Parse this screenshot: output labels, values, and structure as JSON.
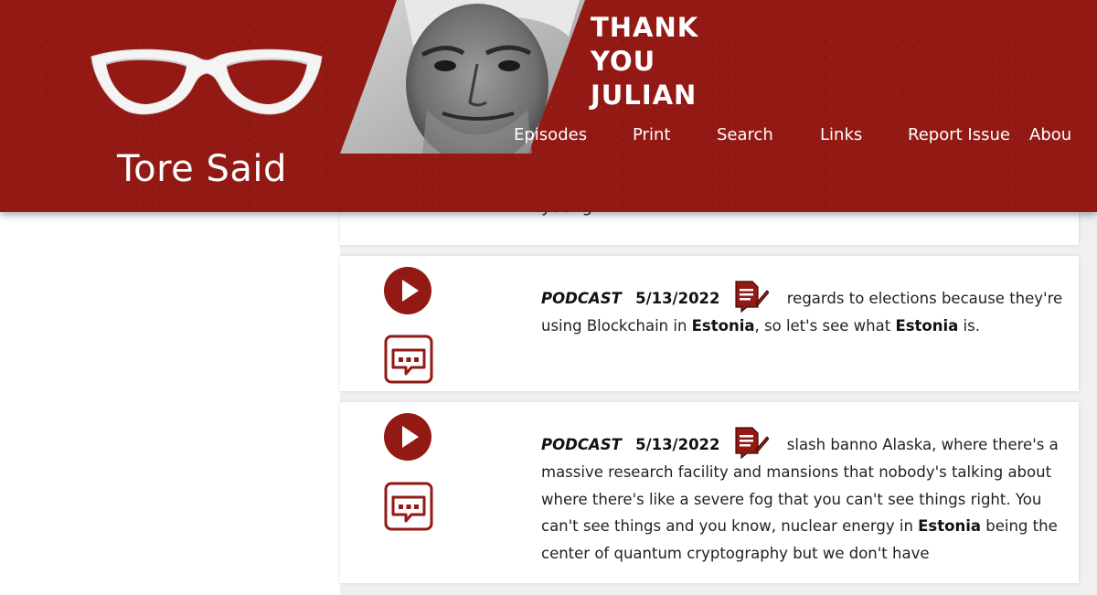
{
  "header": {
    "brand": "Tore Said",
    "banner_lines": [
      "THANK",
      "YOU",
      "JULIAN"
    ],
    "nav": [
      "Episodes",
      "Print",
      "Search",
      "Links",
      "Report Issue",
      "Abou"
    ]
  },
  "top_fragment": "young",
  "entries": [
    {
      "kind": "PODCAST",
      "date": "5/13/2022",
      "segments": [
        {
          "t": "regards to elections because they're using Blockchain in "
        },
        {
          "b": "Estonia"
        },
        {
          "t": ", so let's see what "
        },
        {
          "b": "Estonia"
        },
        {
          "t": " is."
        }
      ]
    },
    {
      "kind": "PODCAST",
      "date": "5/13/2022",
      "segments": [
        {
          "t": "slash banno Alaska, where there's a massive research facility and mansions that nobody's talking about where there's like a severe fog that you can't see things right. You can't see things and you know, nuclear energy in "
        },
        {
          "b": "Estonia"
        },
        {
          "t": " being the center of quantum cryptography but we don't have"
        }
      ]
    }
  ],
  "icons": {
    "glasses": "glasses-logo-icon",
    "play": "play-icon",
    "transcript": "transcript-chat-icon",
    "document": "document-edit-icon"
  },
  "colors": {
    "brand_red": "#931a14",
    "card_bg": "#ffffff",
    "page_bg": "#f0f0f0"
  }
}
